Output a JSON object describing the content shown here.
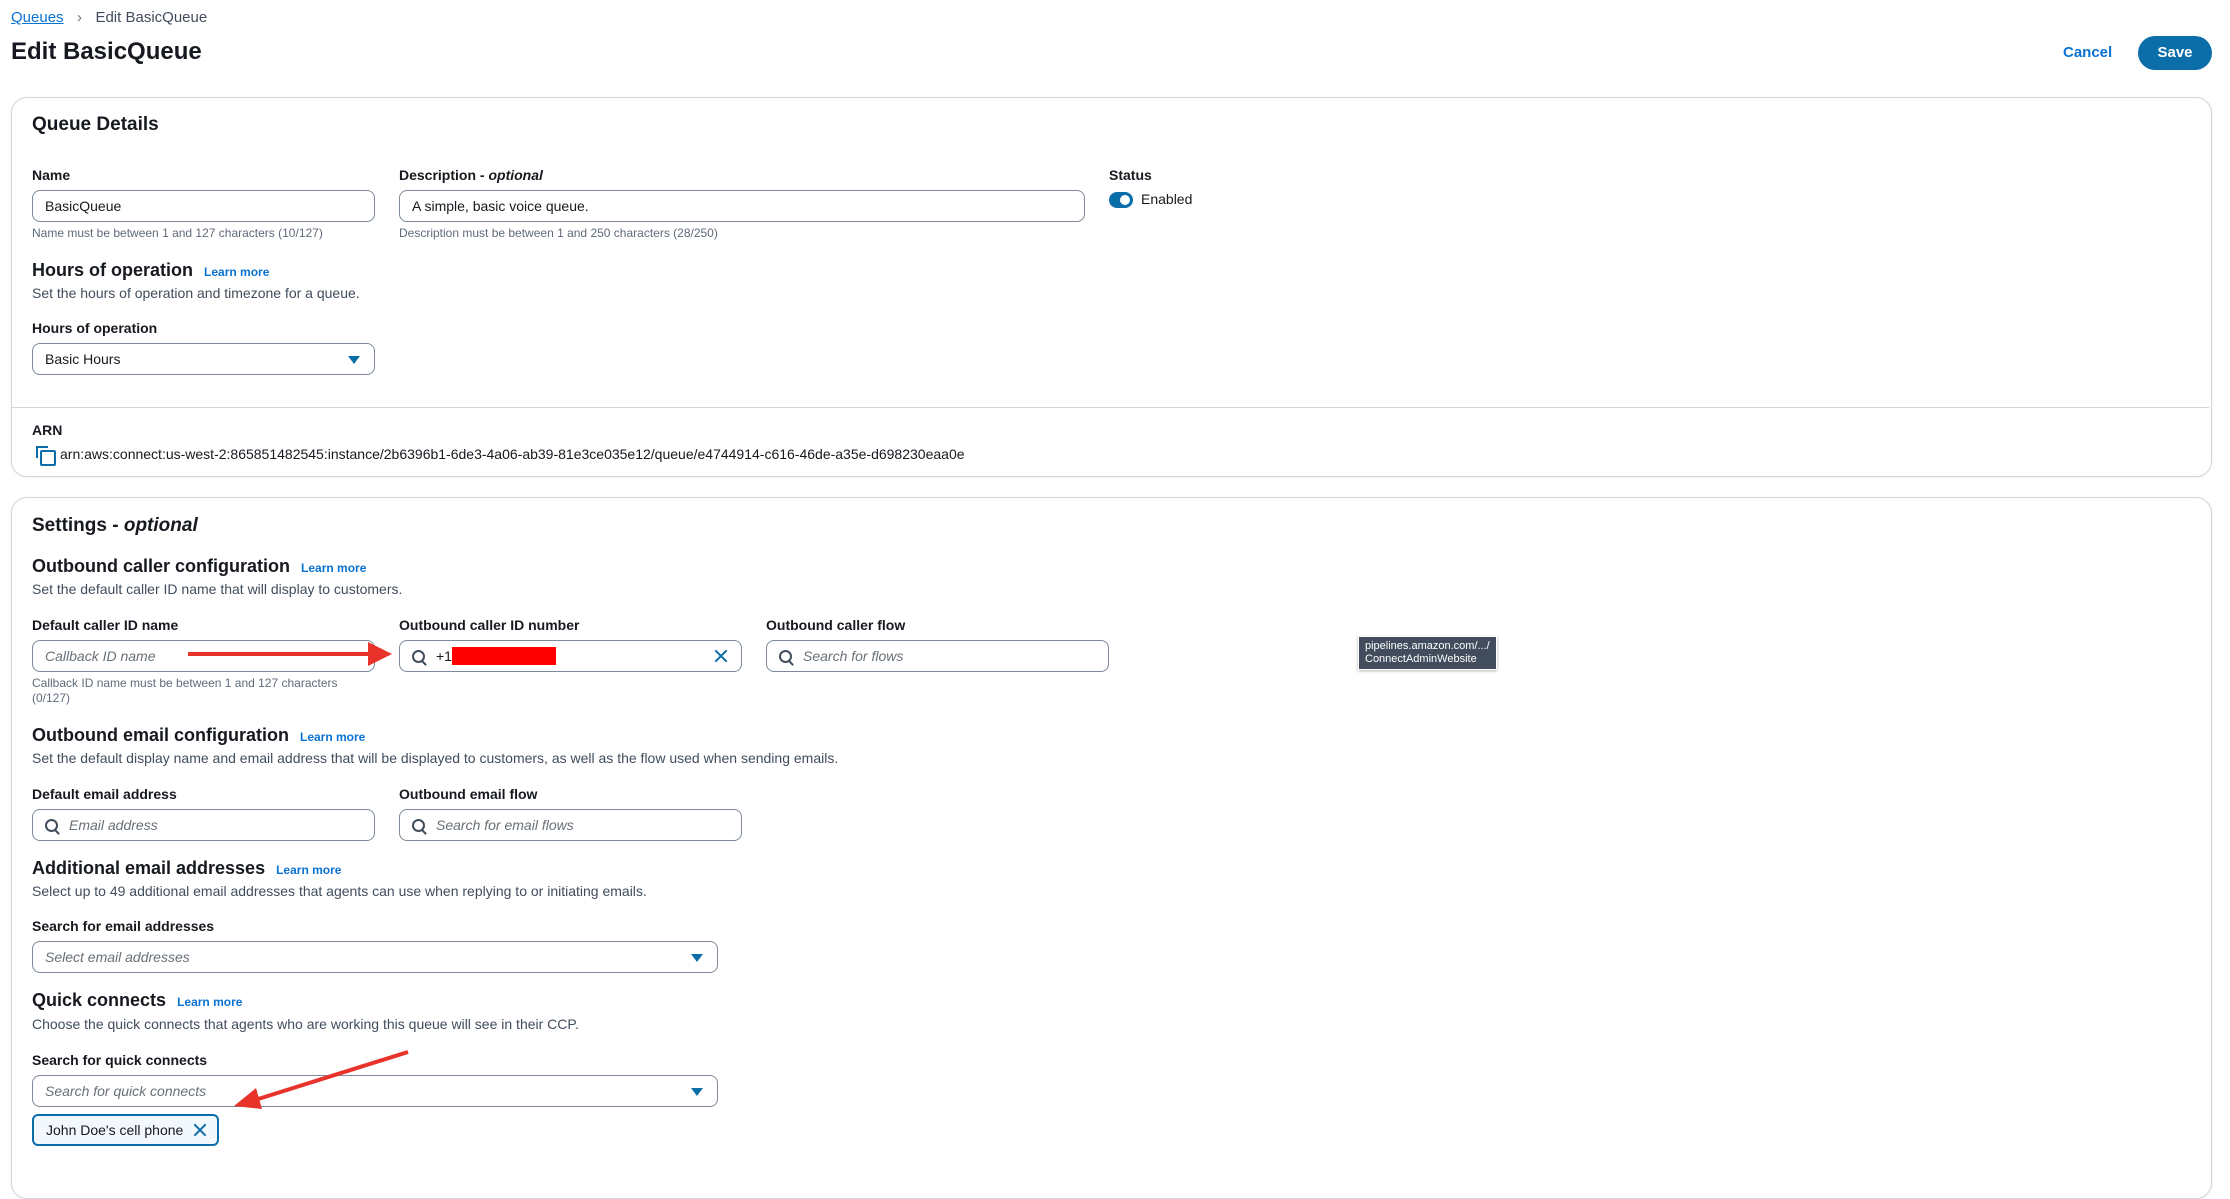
{
  "breadcrumb": {
    "root": "Queues",
    "current": "Edit BasicQueue"
  },
  "page_title": "Edit BasicQueue",
  "actions": {
    "cancel": "Cancel",
    "save": "Save"
  },
  "queue_details": {
    "heading": "Queue Details",
    "name": {
      "label": "Name",
      "value": "BasicQueue",
      "hint": "Name must be between 1 and 127 characters (10/127)"
    },
    "description": {
      "label_main": "Description - ",
      "label_optional": "optional",
      "value": "A simple, basic voice queue.",
      "hint": "Description must be between 1 and 250 characters (28/250)"
    },
    "status": {
      "label": "Status",
      "value": "Enabled"
    },
    "hours": {
      "heading": "Hours of operation",
      "learn_more": "Learn more",
      "description": "Set the hours of operation and timezone for a queue.",
      "label": "Hours of operation",
      "value": "Basic Hours"
    },
    "arn": {
      "label": "ARN",
      "value": "arn:aws:connect:us-west-2:865851482545:instance/2b6396b1-6de3-4a06-ab39-81e3ce035e12/queue/e4744914-c616-46de-a35e-d698230eaa0e"
    }
  },
  "settings": {
    "heading_main": "Settings - ",
    "heading_optional": "optional",
    "outbound_caller": {
      "heading": "Outbound caller configuration",
      "learn_more": "Learn more",
      "description": "Set the default caller ID name that will display to customers.",
      "caller_name": {
        "label": "Default caller ID name",
        "placeholder": "Callback ID name",
        "hint_line1": "Callback ID name must be between 1 and 127 characters",
        "hint_line2": "(0/127)"
      },
      "caller_number": {
        "label": "Outbound caller ID number",
        "value": "+1"
      },
      "caller_flow": {
        "label": "Outbound caller flow",
        "placeholder": "Search for flows"
      }
    },
    "tooltip": {
      "line1": "pipelines.amazon.com/.../",
      "line2": "ConnectAdminWebsite"
    },
    "outbound_email": {
      "heading": "Outbound email configuration",
      "learn_more": "Learn more",
      "description": "Set the default display name and email address that will be displayed to customers, as well as the flow used when sending emails.",
      "email_address": {
        "label": "Default email address",
        "placeholder": "Email address"
      },
      "email_flow": {
        "label": "Outbound email flow",
        "placeholder": "Search for email flows"
      }
    },
    "additional_email": {
      "heading": "Additional email addresses",
      "learn_more": "Learn more",
      "description": "Select up to 49 additional email addresses that agents can use when replying to or initiating emails.",
      "label": "Search for email addresses",
      "placeholder": "Select email addresses"
    },
    "quick_connects": {
      "heading": "Quick connects",
      "learn_more": "Learn more",
      "description": "Choose the quick connects that agents who are working this queue will see in their CCP.",
      "label": "Search for quick connects",
      "placeholder": "Search for quick connects",
      "selected": [
        "John Doe's cell phone"
      ]
    }
  },
  "colors": {
    "accent": "#0b6ea8",
    "link": "#0972d3",
    "annotation": "#e8332a",
    "redaction": "#ff0000"
  }
}
